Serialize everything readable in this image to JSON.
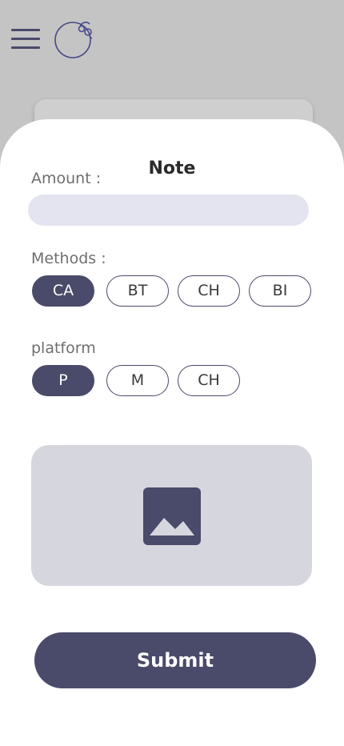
{
  "header": {
    "menu_icon": "hamburger-menu-icon",
    "logo_icon": "bomb-logo-icon"
  },
  "form": {
    "title": "Note",
    "amount": {
      "label": "Amount :",
      "value": "",
      "placeholder": ""
    },
    "methods": {
      "label": "Methods :",
      "options": [
        "CA",
        "BT",
        "CH",
        "BI"
      ],
      "selected": "CA"
    },
    "platform": {
      "label": "platform",
      "options": [
        "P",
        "M",
        "CH"
      ],
      "selected": "P"
    },
    "upload": {
      "icon": "image-placeholder-icon"
    },
    "submit_label": "Submit"
  },
  "colors": {
    "primary": "#4a4a6a",
    "input_bg": "#e4e4f0",
    "upload_bg": "#d6d6de",
    "backdrop": "#c4c4c4"
  }
}
